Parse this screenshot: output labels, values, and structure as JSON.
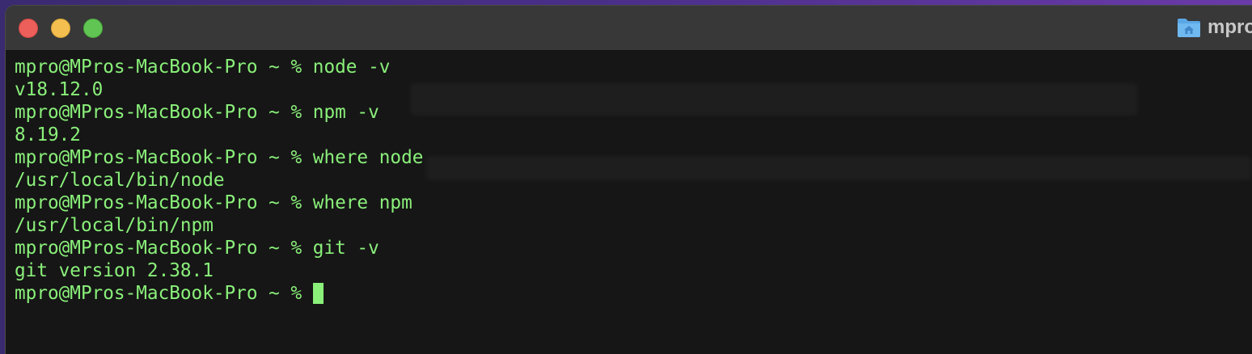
{
  "window": {
    "title": "mpro",
    "title_icon": "home-folder-icon",
    "controls": [
      {
        "name": "close",
        "color": "#ec5f5a"
      },
      {
        "name": "minimize",
        "color": "#f4bf4f"
      },
      {
        "name": "zoom",
        "color": "#61c554"
      }
    ]
  },
  "terminal": {
    "text_color": "#8af07a",
    "background": "#161616",
    "lines": [
      {
        "type": "prompt",
        "prompt": "mpro@MPros-MacBook-Pro ~ %",
        "command": "node -v"
      },
      {
        "type": "output",
        "text": "v18.12.0"
      },
      {
        "type": "prompt",
        "prompt": "mpro@MPros-MacBook-Pro ~ %",
        "command": "npm -v"
      },
      {
        "type": "output",
        "text": "8.19.2"
      },
      {
        "type": "prompt",
        "prompt": "mpro@MPros-MacBook-Pro ~ %",
        "command": "where node"
      },
      {
        "type": "output",
        "text": "/usr/local/bin/node"
      },
      {
        "type": "prompt",
        "prompt": "mpro@MPros-MacBook-Pro ~ %",
        "command": "where npm"
      },
      {
        "type": "output",
        "text": "/usr/local/bin/npm"
      },
      {
        "type": "prompt",
        "prompt": "mpro@MPros-MacBook-Pro ~ %",
        "command": "git -v"
      },
      {
        "type": "output",
        "text": "git version 2.38.1"
      },
      {
        "type": "active_prompt",
        "prompt": "mpro@MPros-MacBook-Pro ~ %",
        "command": ""
      }
    ]
  }
}
